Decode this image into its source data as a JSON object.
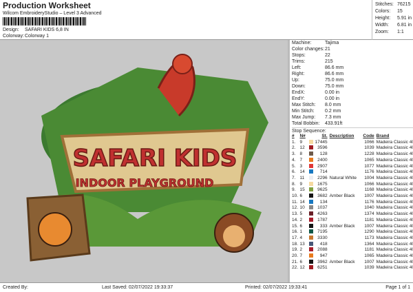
{
  "header": {
    "title": "Production Worksheet",
    "subtitle": "Wilcom EmbroideryStudio – Level 3 Advanced",
    "design_label": "Design:",
    "design": "SAFARI KIDS 6,8 IN",
    "colorway_label": "Colorway:",
    "colorway": "Colorway 1"
  },
  "stats": [
    [
      "Stitches:",
      "76215"
    ],
    [
      "Colors:",
      "15"
    ],
    [
      "Height:",
      "5.91 in"
    ],
    [
      "Width:",
      "6.81 in"
    ],
    [
      "Zoom:",
      "1:1"
    ]
  ],
  "design_text": {
    "line1": "SAFARI KIDS",
    "line2": "INDOOR PLAYGROUND"
  },
  "machine": [
    [
      "Machine:",
      "Tajima"
    ],
    [
      "Color changes:",
      "21"
    ],
    [
      "Stops:",
      "22"
    ],
    [
      "Trims:",
      "215"
    ],
    [
      "Left:",
      "86.6 mm"
    ],
    [
      "Right:",
      "86.6 mm"
    ],
    [
      "Up:",
      "75.0 mm"
    ],
    [
      "Down:",
      "75.0 mm"
    ],
    [
      "EndX:",
      "0.00 in"
    ],
    [
      "EndY:",
      "0.00 in"
    ],
    [
      "Max Stitch:",
      "8.0 mm"
    ],
    [
      "Min Stitch:",
      "0.2 mm"
    ],
    [
      "Max Jump:",
      "7.3 mm"
    ],
    [
      "Total Bobbin:",
      "433.91ft"
    ]
  ],
  "stop_sequence_label": "Stop Sequence:",
  "columns": [
    "#",
    "N#",
    "St.",
    "Description",
    "Code",
    "Brand"
  ],
  "stops": [
    [
      "1.",
      "9",
      "#f5d9a0",
      "17445",
      "",
      "1066",
      "Madeira Classic 40"
    ],
    [
      "2.",
      "12",
      "#a01c22",
      "3596",
      "",
      "1039",
      "Madeira Classic 40"
    ],
    [
      "3.",
      "8",
      "#6e5a4a",
      "128",
      "",
      "1228",
      "Madeira Classic 40"
    ],
    [
      "4.",
      "7",
      "#e87a1e",
      "2400",
      "",
      "1065",
      "Madeira Classic 40"
    ],
    [
      "5.",
      "3",
      "#e03838",
      "2907",
      "",
      "1077",
      "Madeira Classic 40"
    ],
    [
      "6.",
      "14",
      "#1878c0",
      "714",
      "",
      "1176",
      "Madeira Classic 40"
    ],
    [
      "7.",
      "11",
      "#eceef2",
      "2296",
      "Natural White",
      "1004",
      "Madeira Classic 40"
    ],
    [
      "8.",
      "9",
      "#f5d9a0",
      "1675",
      "",
      "1066",
      "Madeira Classic 40"
    ],
    [
      "9.",
      "15",
      "#80a040",
      "9625",
      "",
      "1168",
      "Madeira Classic 40"
    ],
    [
      "10.",
      "6",
      "#151515",
      "3682",
      "Amber Black",
      "1007",
      "Madeira Classic 40"
    ],
    [
      "11.",
      "14",
      "#1878c0",
      "134",
      "",
      "1176",
      "Madeira Classic 40"
    ],
    [
      "12.",
      "10",
      "#888888",
      "1037",
      "",
      "1040",
      "Madeira Classic 40"
    ],
    [
      "13.",
      "5",
      "#6a2028",
      "4263",
      "",
      "1374",
      "Madeira Classic 40"
    ],
    [
      "14.",
      "2",
      "#a81c2a",
      "1787",
      "",
      "1181",
      "Madeira Classic 40"
    ],
    [
      "15.",
      "6",
      "#151515",
      "333",
      "Amber Black",
      "1007",
      "Madeira Classic 40"
    ],
    [
      "16.",
      "1",
      "#105848",
      "7195",
      "",
      "1290",
      "Madeira Classic 40"
    ],
    [
      "17.",
      "4",
      "#c87830",
      "3330",
      "",
      "1173",
      "Madeira Classic 40"
    ],
    [
      "18.",
      "13",
      "#485878",
      "418",
      "",
      "1364",
      "Madeira Classic 40"
    ],
    [
      "19.",
      "2",
      "#a81c2a",
      "2088",
      "",
      "1181",
      "Madeira Classic 40"
    ],
    [
      "20.",
      "7",
      "#e87a1e",
      "947",
      "",
      "1065",
      "Madeira Classic 40"
    ],
    [
      "21.",
      "6",
      "#151515",
      "3962",
      "Amber Black",
      "1007",
      "Madeira Classic 40"
    ],
    [
      "22.",
      "12",
      "#a01c22",
      "6251",
      "",
      "1039",
      "Madeira Classic 40"
    ]
  ],
  "footer": {
    "created": "Created By:",
    "saved": "Last Saved: 02/07/2022 19:33:37",
    "printed": "Printed: 02/07/2022 19:33:41",
    "page": "Page 1 of 1"
  }
}
